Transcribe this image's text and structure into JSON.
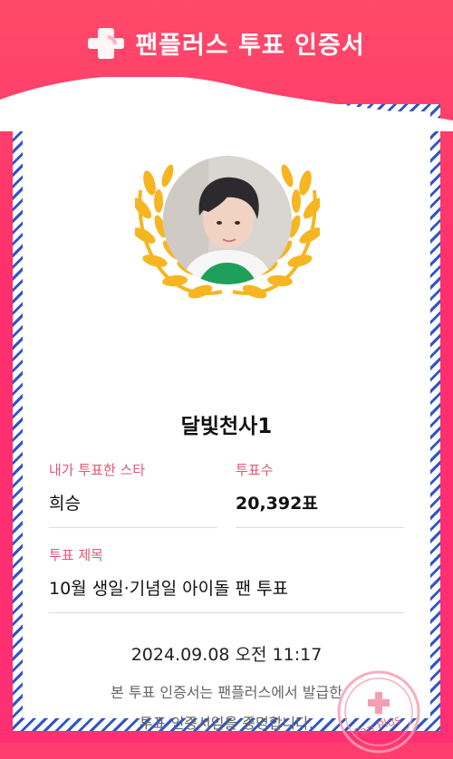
{
  "header": {
    "title": "팬플러스 투표 인증서",
    "logo_icon": "fanplus-logo-icon"
  },
  "certificate": {
    "nickname": "달빛천사1",
    "star_label": "내가 투표한 스타",
    "star_name": "희승",
    "votes_label": "투표수",
    "votes_value": "20,392표",
    "vote_title_label": "투표 제목",
    "vote_title": "10월 생일·기념일 아이돌 팬 투표",
    "datetime": "2024.09.08 오전 11:17",
    "note_line1": "본 투표 인증서는 팬플러스에서 발급한",
    "note_line2": "투표 인증서임을 증명합니다.",
    "stamp_text": "Fan Plus"
  },
  "colors": {
    "accent": "#ff3d6e",
    "stripe": "#2f55c7",
    "label": "#e45577",
    "wreath": "#f5b622"
  }
}
